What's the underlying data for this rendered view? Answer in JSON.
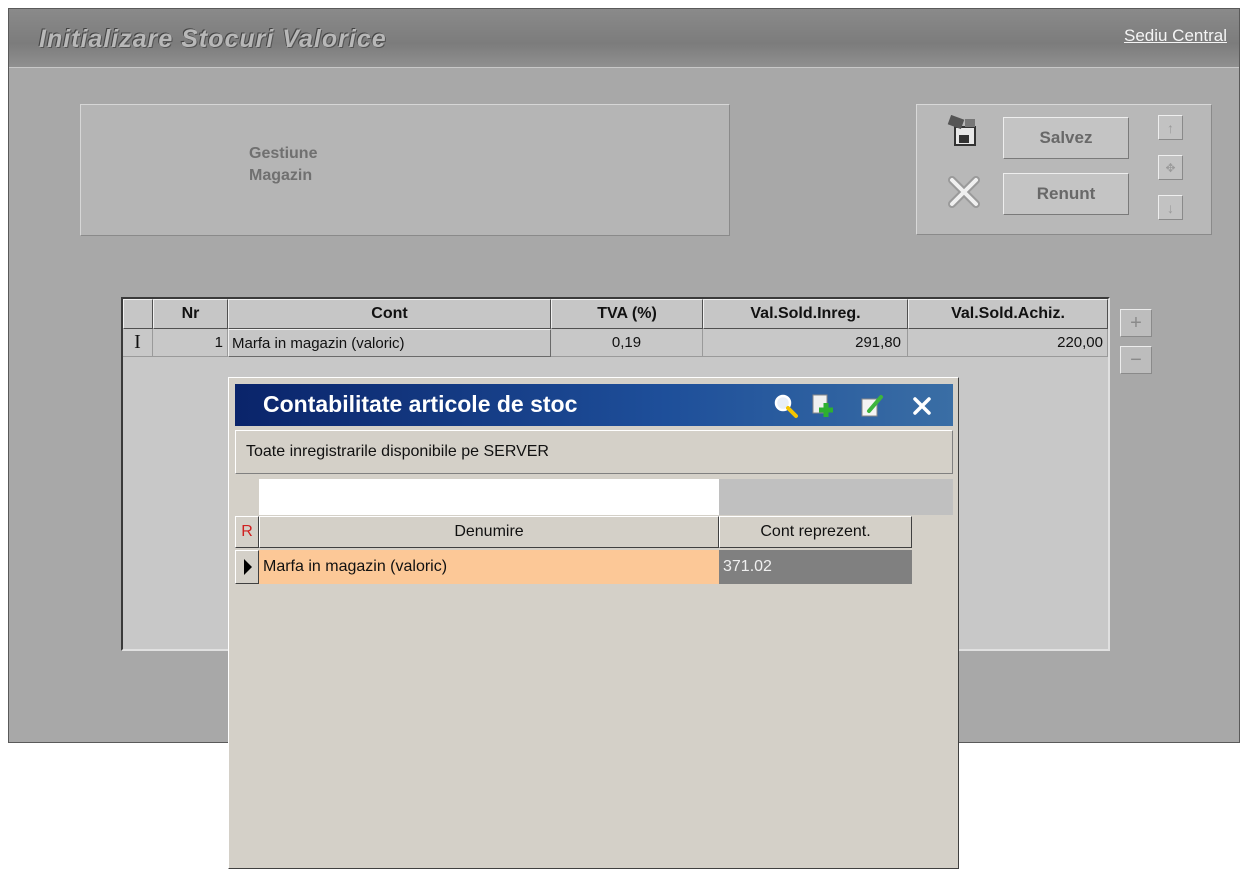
{
  "window": {
    "title": "Initializare Stocuri Valorice",
    "location_link": "Sediu Central"
  },
  "gestiune": {
    "line1": "Gestiune",
    "line2": "Magazin"
  },
  "actions": {
    "save_label": "Salvez",
    "cancel_label": "Renunt"
  },
  "grid": {
    "columns": [
      "Nr",
      "Cont",
      "TVA (%)",
      "Val.Sold.Inreg.",
      "Val.Sold.Achiz."
    ],
    "rows": [
      {
        "nr": "1",
        "cont": "Marfa in magazin (valoric)",
        "tva": "0,19",
        "val_inreg": "291,80",
        "val_achiz": "220,00"
      }
    ]
  },
  "lookup": {
    "title": "Contabilitate articole de stoc",
    "info": "Toate inregistrarile disponibile pe SERVER",
    "search_value": "",
    "col_marker": "R",
    "columns": [
      "Denumire",
      "Cont reprezent."
    ],
    "rows": [
      {
        "denumire": "Marfa in magazin (valoric)",
        "cont": "371.02"
      }
    ],
    "icons": [
      "search-icon",
      "add-icon",
      "edit-icon",
      "close-icon"
    ]
  },
  "colors": {
    "selected_row": "#fcc897",
    "selected_cell": "#808080",
    "title_blue": "#0a246a"
  }
}
